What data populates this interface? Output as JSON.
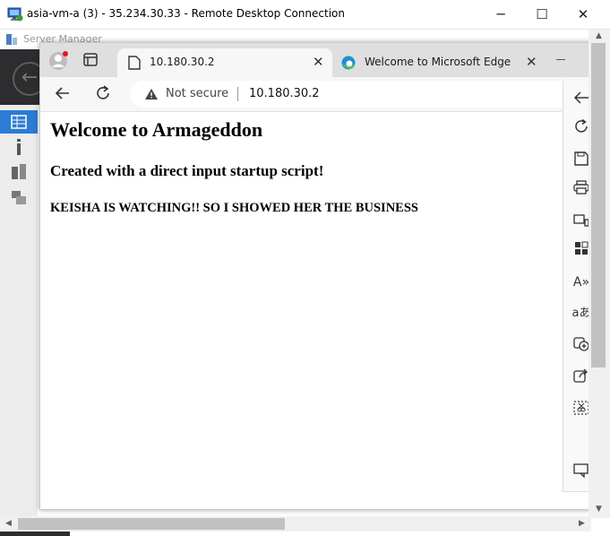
{
  "rdp": {
    "title": "asia-vm-a (3) - 35.234.30.33 - Remote Desktop Connection",
    "minimize": "─",
    "maximize": "☐",
    "close": "✕"
  },
  "server_manager": {
    "title": "Server Manager"
  },
  "edge": {
    "tabs": [
      {
        "label": "10.180.30.2",
        "active": true
      },
      {
        "label": "Welcome to Microsoft Edge",
        "active": false
      }
    ],
    "tab_close": "✕",
    "address": {
      "security_label": "Not secure",
      "url": "10.180.30.2"
    }
  },
  "page": {
    "heading1": "Welcome to Armageddon",
    "heading2": "Created with a direct input startup script!",
    "heading3": "KEISHA IS WATCHING!! SO I SHOWED HER THE BUSINESS"
  },
  "colors": {
    "accent_blue": "#0078d4",
    "server_manager_header": "#2d2d30",
    "tabstrip": "#dfdfdf"
  }
}
